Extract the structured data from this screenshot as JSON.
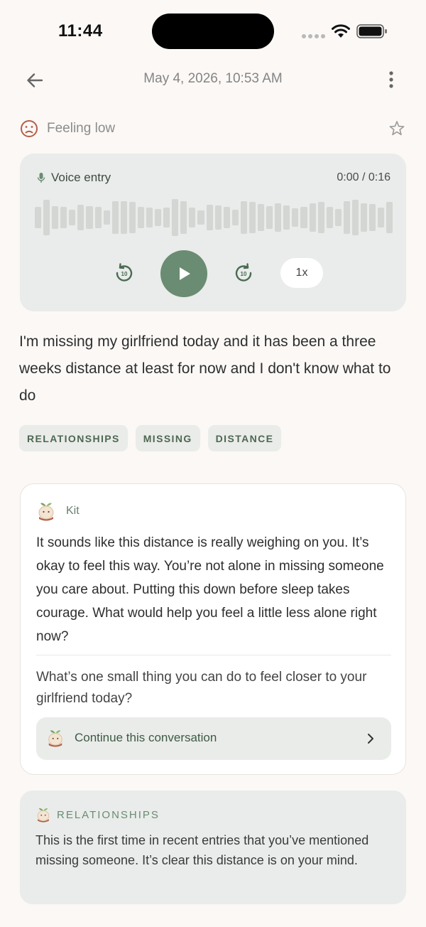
{
  "status_bar": {
    "time": "11:44"
  },
  "header": {
    "date": "May 4, 2026, 10:53 AM"
  },
  "mood": {
    "label": "Feeling low",
    "icon": "sad-face-icon"
  },
  "voice": {
    "label": "Voice entry",
    "time": "0:00 / 0:16",
    "speed": "1x",
    "rewind_label": "10",
    "forward_label": "10",
    "progress": 0
  },
  "entry": {
    "text": "I'm missing my girlfriend today and it has been a three weeks distance at least for now and I don't know what to do"
  },
  "tags": [
    "RELATIONSHIPS",
    "MISSING",
    "DISTANCE"
  ],
  "kit": {
    "name": "Kit",
    "message": "It sounds like this distance is really weighing on you. It’s okay to feel this way. You’re not alone in missing someone you care about. Putting this down before sleep takes courage. What would help you feel a little less alone right now?",
    "question": "What’s one small thing you can do to feel closer to your girlfriend today?",
    "continue_label": "Continue this conversation"
  },
  "insight": {
    "title": "RELATIONSHIPS",
    "text": "This is the first time in recent entries that you’ve mentioned missing someone. It’s clear this distance is on your mind."
  },
  "colors": {
    "accent": "#6a8c72",
    "background": "#fbf8f6",
    "card": "#e9ecea",
    "mood": "#b35f48"
  }
}
